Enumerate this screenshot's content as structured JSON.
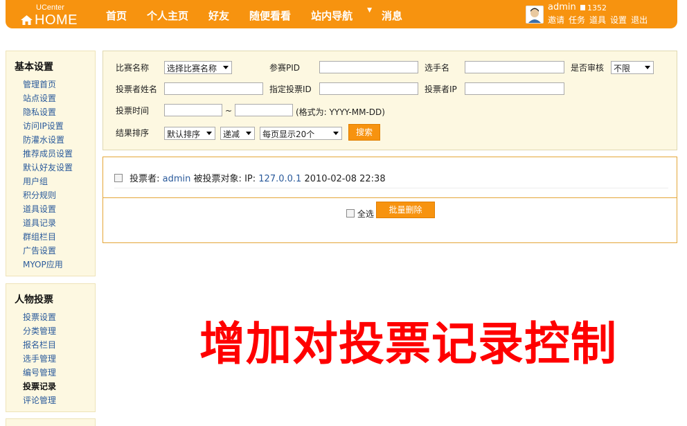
{
  "header": {
    "logo_small": "UCenter",
    "logo_home": "HOME",
    "nav": [
      "首页",
      "个人主页",
      "好友",
      "随便看看",
      "站内导航",
      "消息"
    ],
    "user": {
      "name": "admin",
      "credit": "1352"
    },
    "user_links": [
      "邀请",
      "任务",
      "道具",
      "设置",
      "退出"
    ]
  },
  "sidebar": {
    "section1": {
      "title": "基本设置",
      "items": [
        "管理首页",
        "站点设置",
        "隐私设置",
        "访问IP设置",
        "防灌水设置",
        "推荐成员设置",
        "默认好友设置",
        "用户组",
        "积分规则",
        "道具设置",
        "道具记录",
        "群组栏目",
        "广告设置",
        "MYOP应用"
      ]
    },
    "section2": {
      "title": "人物投票",
      "items": [
        "投票设置",
        "分类管理",
        "报名栏目",
        "选手管理",
        "编号管理",
        "投票记录",
        "评论管理"
      ],
      "active_index": 5
    }
  },
  "search": {
    "match_name_label": "比赛名称",
    "match_name_select": "选择比赛名称",
    "pid_label": "参赛PID",
    "player_name_label": "选手名",
    "audit_label": "是否审核",
    "audit_select": "不限",
    "voter_name_label": "投票者姓名",
    "vote_id_label": "指定投票ID",
    "voter_ip_label": "投票者IP",
    "vote_time_label": "投票时间",
    "tilde": "~",
    "date_hint": "(格式为: YYYY-MM-DD)",
    "sort_label": "结果排序",
    "sort_select": "默认排序",
    "order_select": "递减",
    "per_page_select": "每页显示20个",
    "search_button": "搜索"
  },
  "records": [
    {
      "voter_label": "投票者:",
      "voter": "admin",
      "target_label": "被投票对象:",
      "ip_label": "IP:",
      "ip": "127.0.0.1",
      "time": "2010-02-08 22:38"
    }
  ],
  "actions": {
    "select_all": "全选",
    "batch_delete": "批量删除"
  },
  "overlay_text": "增加对投票记录控制",
  "colors": {
    "brand": "#f7930f",
    "sidebar_bg": "#fdf8e1",
    "link": "#2a5a9b",
    "overlay": "#ff0000"
  }
}
